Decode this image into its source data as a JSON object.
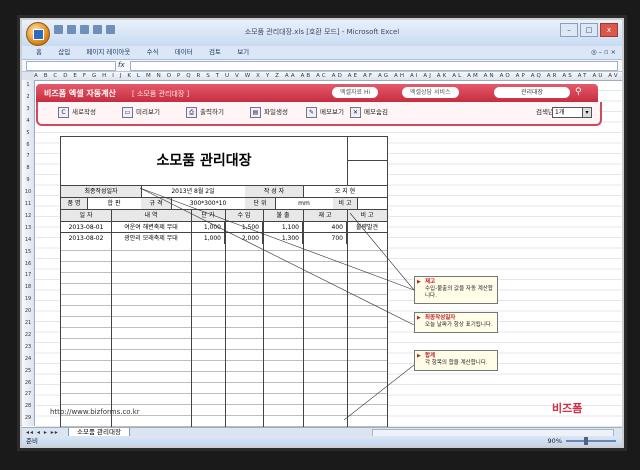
{
  "window": {
    "title": "소모품 관리대장.xls  [호환 모드] - Microsoft Excel",
    "controls": [
      "–",
      "□",
      "x"
    ]
  },
  "menu": [
    "홈",
    "삽입",
    "페이지 레이아웃",
    "수식",
    "데이터",
    "검토",
    "보기"
  ],
  "formula_bar": {
    "fx": "fx"
  },
  "columns": "A B C D E F G H I J K L M N O P Q R S T U V W X Y Z AA AB AC AD AE AF AG AH AI AJ AK AL AM AN AO AP AQ AR AS AT AU AV AW AX AY AZ BA BB BC",
  "rows": [
    "1",
    "2",
    "3",
    "4",
    "5",
    "6",
    "7",
    "8",
    "9",
    "10",
    "11",
    "12",
    "13",
    "14",
    "15",
    "16",
    "17",
    "18",
    "19",
    "20",
    "21",
    "22",
    "23",
    "24",
    "25",
    "26",
    "27",
    "28",
    "29"
  ],
  "banner": {
    "logo": "비즈폼 엑셀 자동계산",
    "subtitle": "[ 소모품 관리대장 ]",
    "link1": "엑셀자료 Hi",
    "link2": "엑셀상담 서비스",
    "search_value": "관리대장"
  },
  "toolbar": {
    "new": "새로작성",
    "preview": "미리보기",
    "print": "출력하기",
    "save_file": "파일생성",
    "memo_view": "메모보기",
    "memo_hide": "메모숨김",
    "year_label": "검색년",
    "year_value": "1개"
  },
  "form": {
    "title": "소모품 관리대장",
    "last_created_label": "최종작성일자",
    "last_created_value": "2013년 8월 2일",
    "author_label": "작 성 자",
    "author_value": "오 지 현",
    "item_label": "품 명",
    "item_value": "합 판",
    "spec_label": "규 격",
    "spec_value": "300*300*10",
    "unit_label": "단 위",
    "unit_value": "mm",
    "note_label": "비 고",
    "headers": [
      "일 자",
      "내 역",
      "단 가",
      "수 입",
      "불 출",
      "재 고",
      "비 고"
    ],
    "rows": [
      [
        "2013-08-01",
        "여운여 해변축제 무대",
        "1,000",
        "1,500",
        "1,100",
        "400",
        "불량발견"
      ],
      [
        "2013-08-02",
        "광안리 모래축제 무대",
        "1,000",
        "2,000",
        "1,300",
        "700",
        ""
      ]
    ]
  },
  "notes": [
    {
      "title": "재고",
      "body": "수입-불출의 값을 자동 계산합니다."
    },
    {
      "title": "최종작성일자",
      "body": "오늘 날짜가 항상 표기됩니다."
    },
    {
      "title": "합계",
      "body": "각 항목의 합을 계산합니다."
    }
  ],
  "footer": {
    "url": "http://www.bizforms.co.kr",
    "brand": "비즈폼",
    "sheet_tab": "소모품 관리대장",
    "status": "준비",
    "zoom": "90%"
  }
}
